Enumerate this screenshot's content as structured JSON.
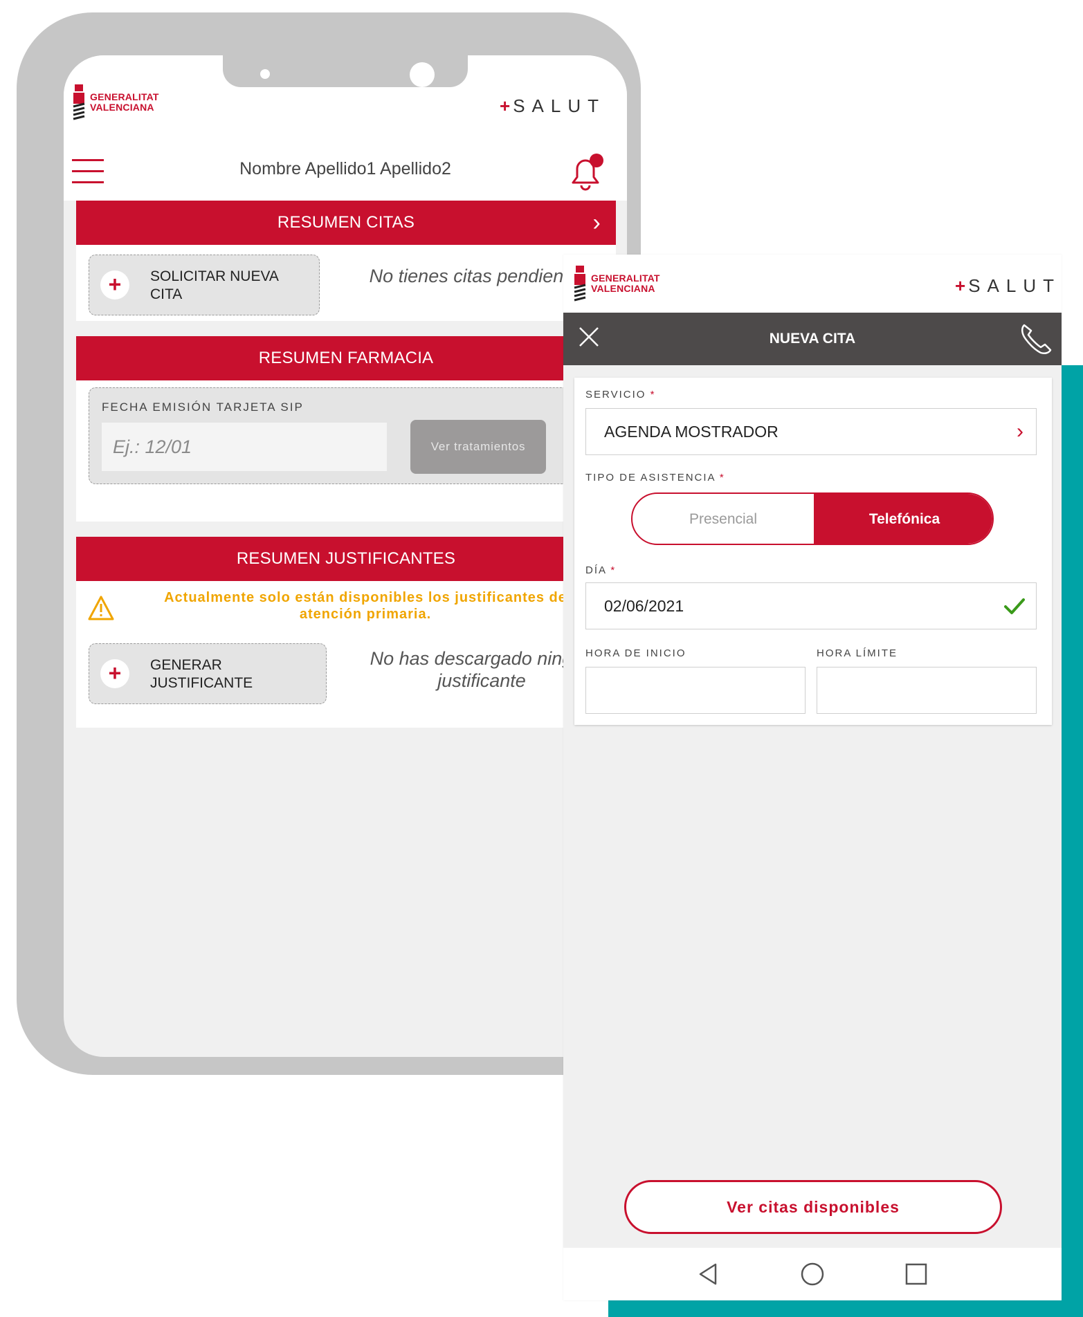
{
  "left_screen": {
    "logo_text_line1": "GENERALITAT",
    "logo_text_line2": "VALENCIANA",
    "brand_plus": "+",
    "brand_name": "SALUT",
    "user_name": "Nombre Apellido1 Apellido2",
    "citas": {
      "title": "RESUMEN CITAS",
      "chevron": "›",
      "add_button_label_line1": "SOLICITAR NUEVA",
      "add_button_label_line2": "CITA",
      "empty_message": "No tienes citas pendientes"
    },
    "farmacia": {
      "title": "RESUMEN FARMACIA",
      "date_label": "FECHA EMISIÓN TARJETA SIP",
      "date_placeholder": "Ej.: 12/01",
      "button_label": "Ver tratamientos"
    },
    "justificantes": {
      "title": "RESUMEN JUSTIFICANTES",
      "warning_line1": "Actualmente solo están disponibles los justificantes de",
      "warning_line2": "atención primaria.",
      "add_button_label_line1": "GENERAR",
      "add_button_label_line2": "JUSTIFICANTE",
      "empty_message_line1": "No has descargado ningún",
      "empty_message_line2": "justificante"
    }
  },
  "right_screen": {
    "logo_text_line1": "GENERALITAT",
    "logo_text_line2": "VALENCIANA",
    "brand_plus": "+",
    "brand_name": "SALUT",
    "title": "NUEVA CITA",
    "servicio_label": "SERVICIO",
    "required_mark": "*",
    "servicio_value": "AGENDA MOSTRADOR",
    "tipo_label": "TIPO DE ASISTENCIA",
    "tipo_options": [
      "Presencial",
      "Telefónica"
    ],
    "tipo_selected": "Telefónica",
    "dia_label": "DÍA",
    "dia_value": "02/06/2021",
    "hora_inicio_label": "HORA DE INICIO",
    "hora_limite_label": "HORA LÍMITE",
    "cta_label": "Ver citas disponibles"
  },
  "colors": {
    "brand_red": "#c8102e",
    "teal": "#00a3a6",
    "warning": "#f0a500",
    "dark_bar": "#4d4a4a",
    "success": "#3a9a1a"
  },
  "icons": [
    "generalitat-logo-icon",
    "hamburger-menu-icon",
    "notification-bell-icon",
    "chevron-right-icon",
    "plus-icon",
    "warning-icon",
    "close-icon",
    "phone-icon",
    "check-icon",
    "nav-back-icon",
    "nav-home-icon",
    "nav-recents-icon"
  ]
}
